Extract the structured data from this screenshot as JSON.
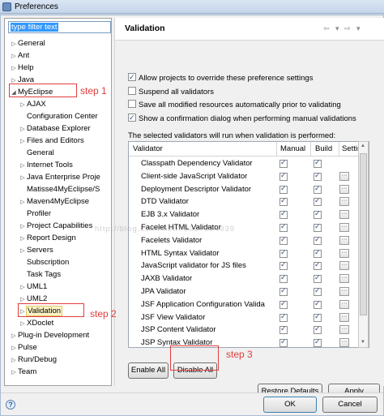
{
  "window": {
    "title": "Preferences"
  },
  "filter": {
    "placeholder": "type filter text"
  },
  "tree": [
    {
      "label": "General",
      "arrow": "▷",
      "indent": 0
    },
    {
      "label": "Ant",
      "arrow": "▷",
      "indent": 0
    },
    {
      "label": "Help",
      "arrow": "▷",
      "indent": 0
    },
    {
      "label": "Java",
      "arrow": "▷",
      "indent": 0
    },
    {
      "label": "MyEclipse",
      "arrow": "◢",
      "indent": 0
    },
    {
      "label": "AJAX",
      "arrow": "▷",
      "indent": 1
    },
    {
      "label": "Configuration Center",
      "arrow": "",
      "indent": 1
    },
    {
      "label": "Database Explorer",
      "arrow": "▷",
      "indent": 1
    },
    {
      "label": "Files and Editors",
      "arrow": "▷",
      "indent": 1
    },
    {
      "label": "General",
      "arrow": "",
      "indent": 1
    },
    {
      "label": "Internet Tools",
      "arrow": "▷",
      "indent": 1
    },
    {
      "label": "Java Enterprise Proje",
      "arrow": "▷",
      "indent": 1
    },
    {
      "label": "Matisse4MyEclipse/S",
      "arrow": "",
      "indent": 1
    },
    {
      "label": "Maven4MyEclipse",
      "arrow": "▷",
      "indent": 1
    },
    {
      "label": "Profiler",
      "arrow": "",
      "indent": 1
    },
    {
      "label": "Project Capabilities",
      "arrow": "▷",
      "indent": 1
    },
    {
      "label": "Report Design",
      "arrow": "▷",
      "indent": 1
    },
    {
      "label": "Servers",
      "arrow": "▷",
      "indent": 1
    },
    {
      "label": "Subscription",
      "arrow": "",
      "indent": 1
    },
    {
      "label": "Task Tags",
      "arrow": "",
      "indent": 1
    },
    {
      "label": "UML1",
      "arrow": "▷",
      "indent": 1
    },
    {
      "label": "UML2",
      "arrow": "▷",
      "indent": 1
    },
    {
      "label": "Validation",
      "arrow": "▷",
      "indent": 1,
      "selected": true
    },
    {
      "label": "XDoclet",
      "arrow": "▷",
      "indent": 1
    },
    {
      "label": "Plug-in Development",
      "arrow": "▷",
      "indent": 0
    },
    {
      "label": "Pulse",
      "arrow": "▷",
      "indent": 0
    },
    {
      "label": "Run/Debug",
      "arrow": "▷",
      "indent": 0
    },
    {
      "label": "Team",
      "arrow": "▷",
      "indent": 0
    }
  ],
  "page": {
    "title": "Validation",
    "nav_back": "⇦",
    "nav_fwd": "⇨",
    "nav_menu": "▾"
  },
  "options": [
    {
      "label": "Allow projects to override these preference settings",
      "checked": true
    },
    {
      "label": "Suspend all validators",
      "checked": false
    },
    {
      "label": "Save all modified resources automatically prior to validating",
      "checked": false
    },
    {
      "label": "Show a confirmation dialog when performing manual validations",
      "checked": true
    }
  ],
  "table": {
    "caption": "The selected validators will run when validation is performed:",
    "columns": [
      "Validator",
      "Manual",
      "Build",
      "Setting"
    ],
    "rows": [
      {
        "name": "Classpath Dependency Validator",
        "manual": true,
        "build": true,
        "settings": false
      },
      {
        "name": "Client-side JavaScript Validator",
        "manual": true,
        "build": true,
        "settings": true
      },
      {
        "name": "Deployment Descriptor Validator",
        "manual": true,
        "build": true,
        "settings": true
      },
      {
        "name": "DTD Validator",
        "manual": true,
        "build": true,
        "settings": true
      },
      {
        "name": "EJB 3.x Validator",
        "manual": true,
        "build": true,
        "settings": true
      },
      {
        "name": "Facelet HTML Validator",
        "manual": true,
        "build": true,
        "settings": true
      },
      {
        "name": "Facelets Validator",
        "manual": true,
        "build": true,
        "settings": true
      },
      {
        "name": "HTML Syntax Validator",
        "manual": true,
        "build": true,
        "settings": true
      },
      {
        "name": "JavaScript validator for JS files",
        "manual": true,
        "build": true,
        "settings": true
      },
      {
        "name": "JAXB Validator",
        "manual": true,
        "build": true,
        "settings": true
      },
      {
        "name": "JPA Validator",
        "manual": true,
        "build": true,
        "settings": true
      },
      {
        "name": "JSF Application Configuration Valida",
        "manual": true,
        "build": true,
        "settings": true
      },
      {
        "name": "JSF View Validator",
        "manual": true,
        "build": true,
        "settings": true
      },
      {
        "name": "JSP Content Validator",
        "manual": true,
        "build": true,
        "settings": true
      },
      {
        "name": "JSP Syntax Validator",
        "manual": true,
        "build": true,
        "settings": true
      }
    ]
  },
  "buttons": {
    "enable_all": "Enable All",
    "disable_all": "Disable All",
    "restore_defaults": "Restore Defaults",
    "apply": "Apply",
    "ok": "OK",
    "cancel": "Cancel"
  },
  "annotations": {
    "step1": "step 1",
    "step2": "step 2",
    "step3": "step 3"
  },
  "watermark": "http://blog.csdn.net/li2327234939",
  "colors": {
    "annotation_red": "#e23c3c",
    "selection": "#3399ff"
  }
}
